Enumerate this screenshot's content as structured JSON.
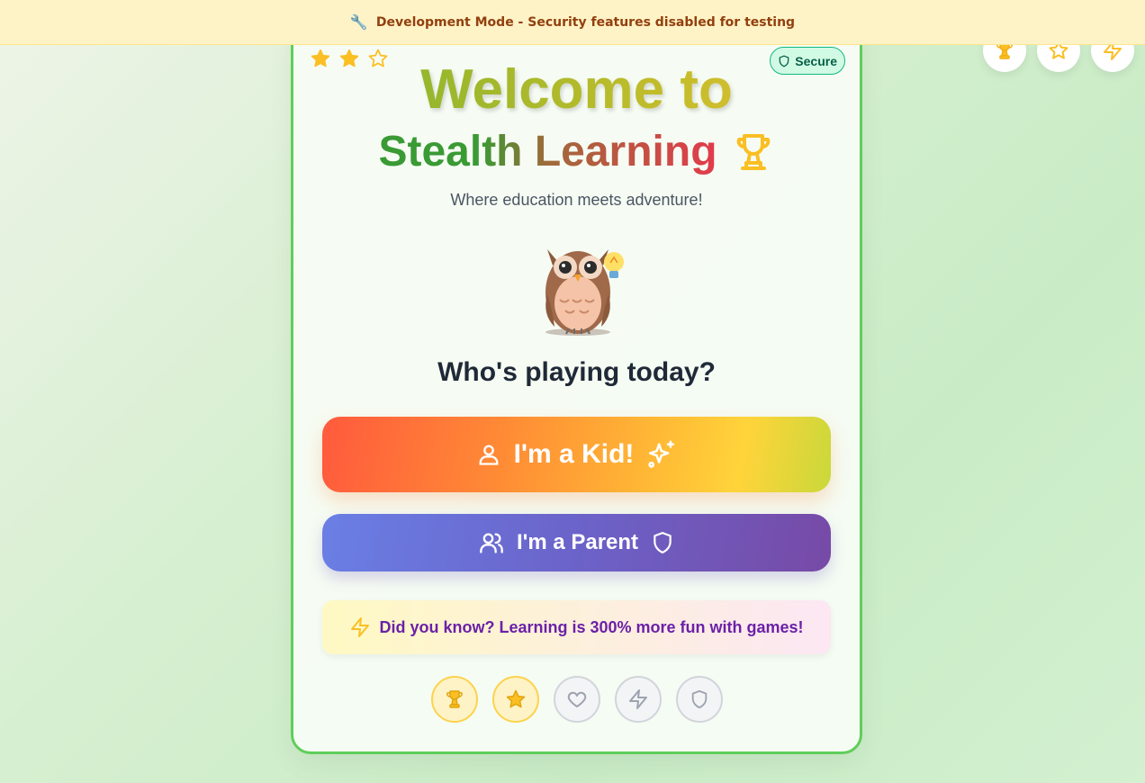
{
  "banner": {
    "icon": "wrench-icon",
    "emoji": "🔧",
    "text": "Development Mode - Security features disabled for testing"
  },
  "corner_badges": [
    "trophy-icon",
    "star-icon",
    "zap-icon"
  ],
  "card": {
    "rating": {
      "value": 2,
      "max": 3
    },
    "secure_label": "Secure",
    "title_line1": "Welcome to",
    "title_line2": "Stealth Learning",
    "subtitle": "Where education meets adventure!",
    "mascot": {
      "name": "owl-mascot",
      "emoji": "🦉",
      "accent_emoji": "💡"
    },
    "question": "Who's playing today?",
    "kid_button": "I'm a Kid!",
    "parent_button": "I'm a Parent",
    "fun_fact": "Did you know? Learning is 300% more fun with games!",
    "achievements": [
      {
        "icon": "trophy-icon",
        "unlocked": true
      },
      {
        "icon": "star-icon",
        "unlocked": true
      },
      {
        "icon": "heart-icon",
        "unlocked": false
      },
      {
        "icon": "zap-icon",
        "unlocked": false
      },
      {
        "icon": "shield-icon",
        "unlocked": false
      }
    ]
  },
  "colors": {
    "banner_bg": "#fef3c7",
    "banner_text": "#92400e",
    "card_border": "#5fce5a",
    "gold": "#fbbf24",
    "secure_bg": "#d1fae5",
    "secure_text": "#065f46",
    "fact_text": "#6b21a8",
    "question_text": "#1f2937"
  }
}
